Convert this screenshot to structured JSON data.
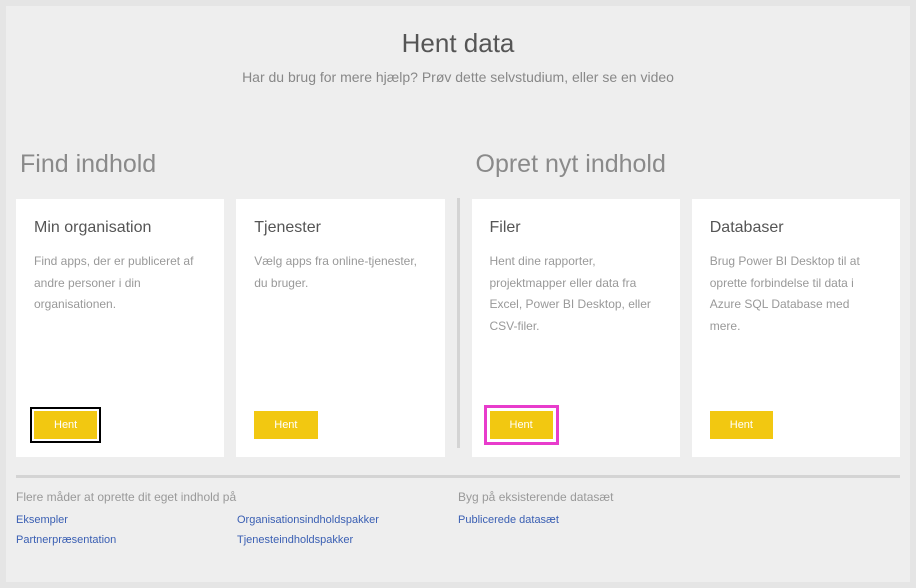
{
  "header": {
    "title": "Hent data",
    "subtitle": "Har du brug for mere hjælp? Prøv dette selvstudium, eller se en video"
  },
  "left_section": {
    "heading": "Find indhold",
    "cards": [
      {
        "title": "Min organisation",
        "desc": "Find apps, der er publiceret af andre personer i din organisationen.",
        "button": "Hent"
      },
      {
        "title": "Tjenester",
        "desc": "Vælg apps fra online-tjenester, du bruger.",
        "button": "Hent"
      }
    ]
  },
  "right_section": {
    "heading": "Opret nyt indhold",
    "cards": [
      {
        "title": "Filer",
        "desc": "Hent dine rapporter, projektmapper eller data fra Excel, Power BI Desktop, eller CSV-filer.",
        "button": "Hent"
      },
      {
        "title": "Databaser",
        "desc": "Brug Power BI Desktop til at oprette forbindelse til data i Azure SQL Database med mere.",
        "button": "Hent"
      }
    ]
  },
  "footer": {
    "left": {
      "title": "Flere måder at oprette dit eget indhold på",
      "col1": [
        "Eksempler",
        "Partnerpræsentation"
      ],
      "col2": [
        "Organisationsindholdspakker",
        "Tjenesteindholdspakker"
      ]
    },
    "right": {
      "title": "Byg på eksisterende datasæt",
      "links": [
        "Publicerede datasæt"
      ]
    }
  }
}
